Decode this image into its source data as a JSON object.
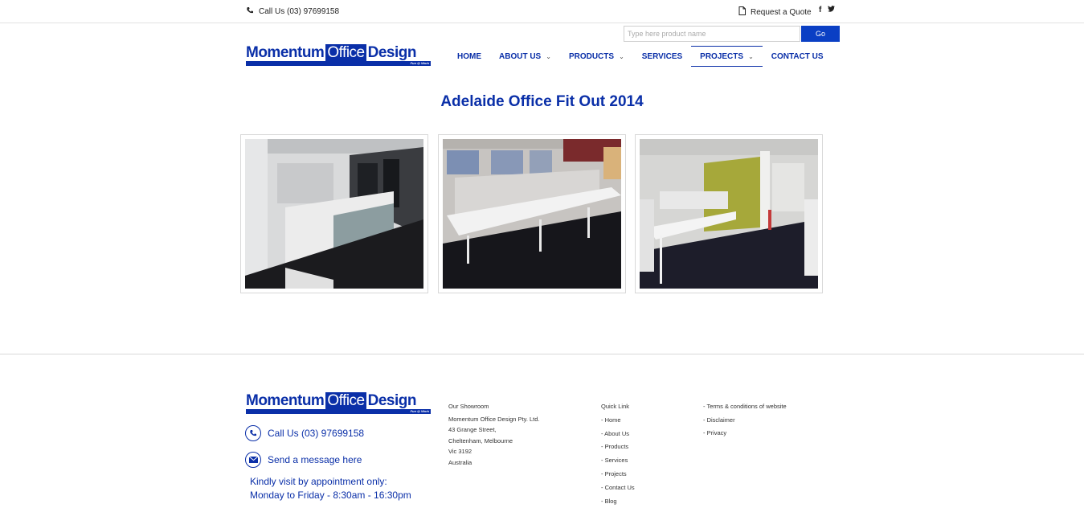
{
  "topbar": {
    "call": "Call Us (03) 97699158",
    "quote": "Request a Quote",
    "social": [
      "f",
      "t"
    ]
  },
  "logo": {
    "part1": "Momentum",
    "part2": "Office",
    "part3": "Design",
    "tagline": "Fun @ Work"
  },
  "search": {
    "placeholder": "Type here product name",
    "button": "Go"
  },
  "nav": {
    "home": "HOME",
    "about": "ABOUT US",
    "products": "PRODUCTS",
    "services": "SERVICES",
    "projects": "PROJECTS",
    "contact": "CONTACT US",
    "chevron": "⌄"
  },
  "page": {
    "title": "Adelaide Office Fit Out 2014"
  },
  "footer": {
    "call": "Call Us (03) 97699158",
    "message": "Send a message here",
    "hours1": "Kindly visit by appointment only:",
    "hours2": "Monday to Friday - 8:30am - 16:30pm",
    "showroom": {
      "heading": "Our Showroom",
      "lines": [
        "Momentum Office Design Pty. Ltd.",
        "43 Grange Street,",
        "Cheltenham, Melbourne",
        "Vic 3192",
        "Australia"
      ]
    },
    "quicklinks": {
      "heading": "Quick Link",
      "items": [
        "- Home",
        "- About Us",
        "- Products",
        "- Services",
        "- Projects",
        "- Contact Us",
        "- Blog"
      ]
    },
    "legal": [
      "- Terms & conditions of website",
      "- Disclaimer",
      "- Privacy"
    ]
  },
  "colors": {
    "brand": "#0a2fa8",
    "button": "#0a3fc4"
  },
  "icons": {
    "phone": "phone-icon",
    "document": "document-icon",
    "envelope": "envelope-icon",
    "facebook": "facebook-icon",
    "twitter": "twitter-icon"
  }
}
